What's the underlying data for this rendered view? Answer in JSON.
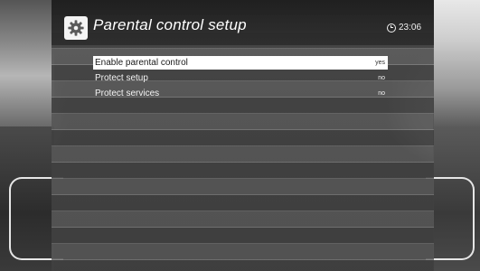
{
  "screen": {
    "title": "Parental control setup",
    "clock": {
      "time": "23:06",
      "icon": "clock-icon"
    },
    "header_icon": "gear-icon"
  },
  "menu": {
    "items": [
      {
        "label": "Enable parental control",
        "value": "yes",
        "selected": true
      },
      {
        "label": "Protect setup",
        "value": "no",
        "selected": false
      },
      {
        "label": "Protect services",
        "value": "no",
        "selected": false
      }
    ]
  },
  "colors": {
    "selection": "#ffffff",
    "text": "#f3f3f3",
    "panel": "#4a4a4a"
  }
}
